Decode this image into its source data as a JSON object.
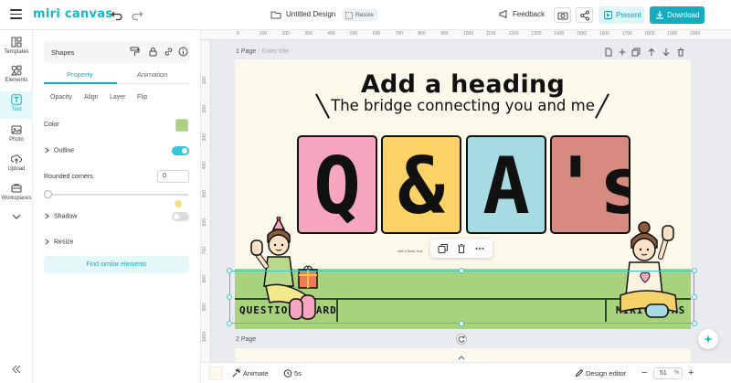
{
  "app": {
    "logo": "miri canvas",
    "doc_title": "Untitled Design",
    "resize_label": "Resize"
  },
  "topbar": {
    "feedback": "Feedback",
    "present": "Present",
    "download": "Download"
  },
  "rail": {
    "items": [
      {
        "label": "Templates",
        "icon": "templates-icon"
      },
      {
        "label": "Elements",
        "icon": "elements-icon"
      },
      {
        "label": "Text",
        "icon": "text-icon"
      },
      {
        "label": "Photo",
        "icon": "photo-icon"
      },
      {
        "label": "Upload",
        "icon": "upload-icon"
      },
      {
        "label": "Workspaces",
        "icon": "workspaces-icon"
      }
    ]
  },
  "panel": {
    "header": "Shapes",
    "tabs": [
      {
        "label": "Property"
      },
      {
        "label": "Animation"
      }
    ],
    "subtabs": [
      "Opacity",
      "Align",
      "Layer",
      "Flip"
    ],
    "color_label": "Color",
    "color_value": "#a9d17f",
    "outline_label": "Outline",
    "outline_on": true,
    "rounded_label": "Rounded corners",
    "rounded_value": "0",
    "shadow_label": "Shadow",
    "shadow_on": false,
    "resize_label": "Resize",
    "find_similar": "Find similar elements"
  },
  "canvas": {
    "ruler_top": [
      "0",
      "100",
      "200",
      "300",
      "400",
      "500",
      "600",
      "700",
      "800",
      "900",
      "1000",
      "1100",
      "1200",
      "1300",
      "1400",
      "1500",
      "1600",
      "1700",
      "1800",
      "1900",
      "2000"
    ],
    "ruler_left": [
      "100",
      "200",
      "300",
      "400",
      "500",
      "600",
      "700",
      "800",
      "900",
      "1000"
    ],
    "page1_label": "1 Page",
    "page1_sub": "- Enter title",
    "page2_label": "2 Page"
  },
  "design": {
    "heading": "Add a heading",
    "subheading": "The bridge connecting you and me",
    "cards": [
      {
        "char": "Q",
        "color": "#f7a6bf"
      },
      {
        "char": "&",
        "color": "#fdd368"
      },
      {
        "char": "A",
        "color": "#a6dbe2"
      },
      {
        "char": "'s",
        "color": "#d78a80"
      }
    ],
    "body_text": "add a body text",
    "left_label": "QUESTIONS CARD",
    "right_label": "MIRICANVAS",
    "band_color": "#a8d37c"
  },
  "bottom": {
    "animate": "Animate",
    "duration": "5s",
    "design_editor": "Design editor",
    "zoom": "51",
    "zoom_unit": "%"
  }
}
